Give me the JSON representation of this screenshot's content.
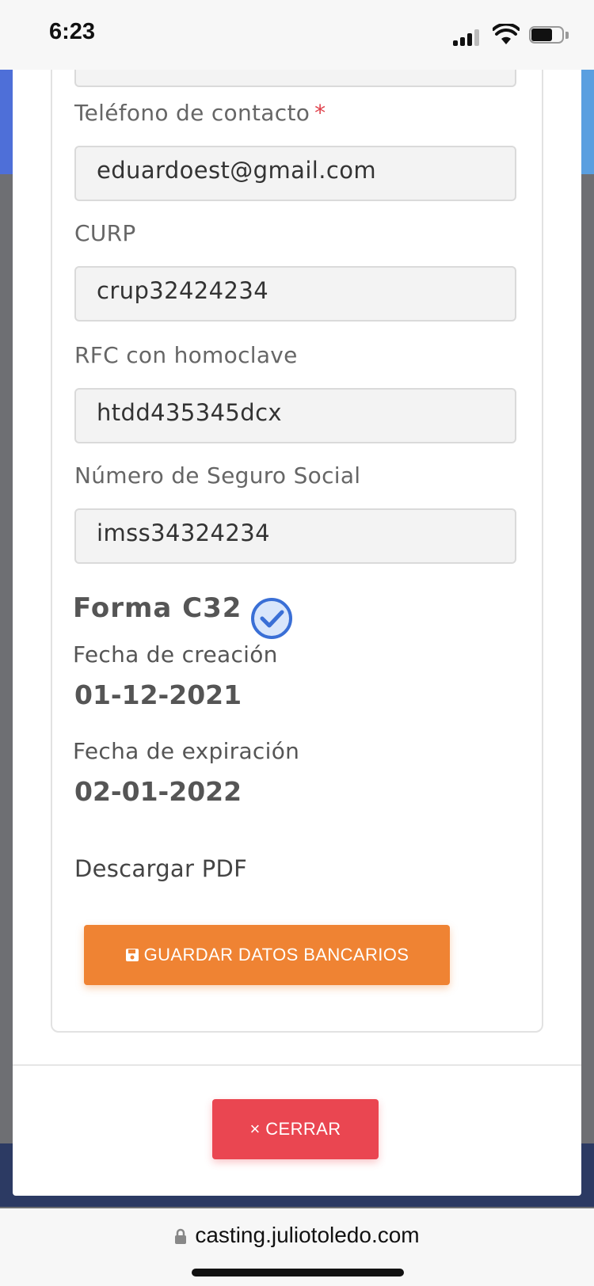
{
  "status_bar": {
    "time": "6:23"
  },
  "form": {
    "fields": [
      {
        "label": "Teléfono de contacto",
        "required_mark": "*",
        "value": "eduardoest@gmail.com"
      },
      {
        "label": "CURP",
        "value": "crup32424234"
      },
      {
        "label": "RFC con homoclave",
        "value": "htdd435345dcx"
      },
      {
        "label": "Número de Seguro Social",
        "value": "imss34324234"
      }
    ],
    "forma": {
      "title": "Forma C32",
      "status_icon": "check-circle-icon",
      "creation_label": "Fecha de creación",
      "creation_date": "01-12-2021",
      "expiration_label": "Fecha de expiración",
      "expiration_date": "02-01-2022",
      "download_link": "Descargar PDF"
    },
    "save_button": {
      "label": "GUARDAR DATOS BANCARIOS",
      "icon": "floppy-disk-icon",
      "color": "#ef8333"
    }
  },
  "modal_footer": {
    "close_button": {
      "label": "× CERRAR",
      "color": "#ea4651"
    }
  },
  "browser": {
    "url": "casting.juliotoledo.com",
    "icon": "lock-icon"
  },
  "colors": {
    "check_blue": "#3a6fd6",
    "required": "#e0424c"
  }
}
